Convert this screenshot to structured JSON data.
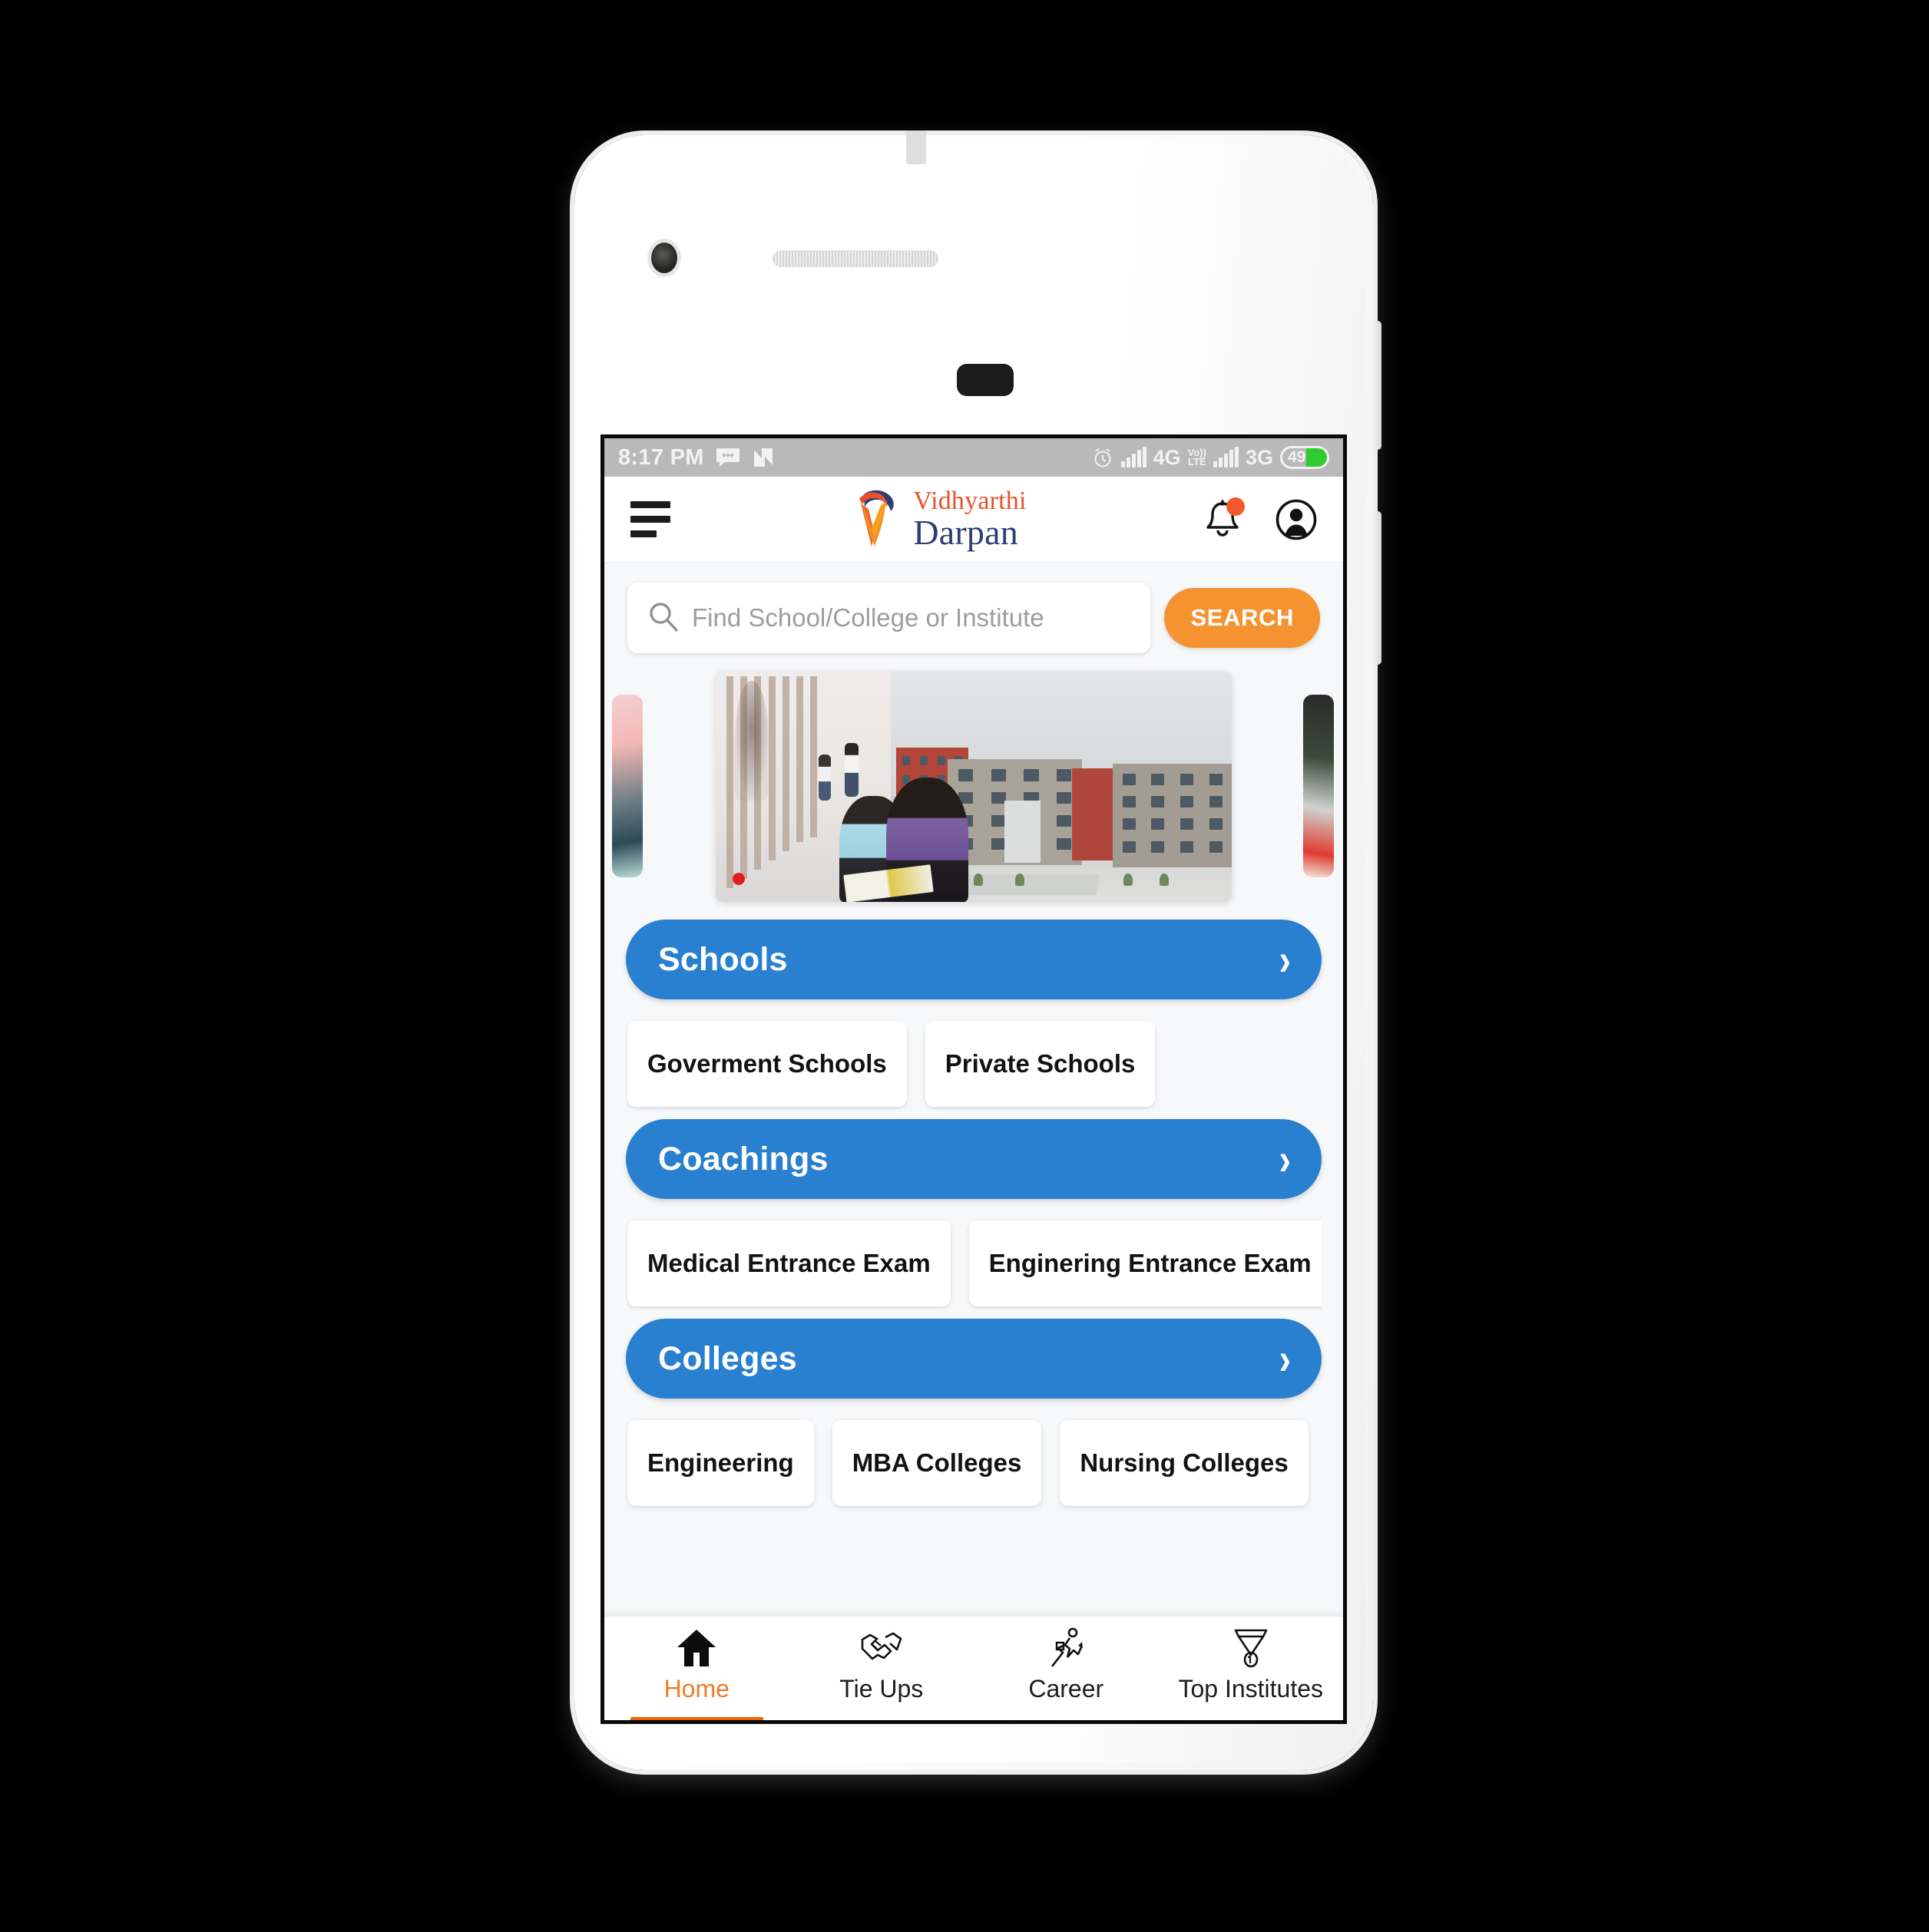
{
  "status_bar": {
    "time": "8:17 PM",
    "icons_left": [
      "sms-icon",
      "nfc-n-icon"
    ],
    "alarm_icon": "alarm-clock-icon",
    "network_1": "4G",
    "volte_top": "Vo))",
    "volte_bottom": "LTE",
    "network_2": "3G",
    "battery_level": "49",
    "bar_bg": "#b9b9b9"
  },
  "app_bar": {
    "menu_icon": "hamburger-menu-icon",
    "brand_line_1": "Vidhyarthi",
    "brand_line_2": "Darpan",
    "brand_color_1": "#e8502a",
    "brand_color_2": "#2e3d73",
    "bell_icon": "notification-bell-icon",
    "bell_badge_color": "#f4592c",
    "profile_icon": "profile-avatar-icon"
  },
  "search": {
    "placeholder": "Find School/College or Institute",
    "value": "",
    "button_label": "SEARCH",
    "button_color": "#f59331",
    "icon": "search-icon"
  },
  "carousel": {
    "active_index": 0,
    "dot_color": "#e02020",
    "slides": [
      "college-campus-students-banner",
      "previous-slide-peek",
      "next-slide-peek"
    ]
  },
  "sections": [
    {
      "title": "Schools",
      "chevron": "›",
      "color": "#2980d0",
      "chips": [
        "Goverment Schools",
        "Private Schools"
      ]
    },
    {
      "title": "Coachings",
      "chevron": "›",
      "color": "#2980d0",
      "chips": [
        "Medical Entrance Exam",
        "Enginering Entrance Exam"
      ]
    },
    {
      "title": "Colleges",
      "chevron": "›",
      "color": "#2980d0",
      "chips": [
        "Engineering",
        "MBA Colleges",
        "Nursing Colleges"
      ]
    }
  ],
  "bottom_nav": {
    "active_color": "#f07b23",
    "items": [
      {
        "label": "Home",
        "icon": "home-icon",
        "active": true
      },
      {
        "label": "Tie Ups",
        "icon": "handshake-icon",
        "active": false
      },
      {
        "label": "Career",
        "icon": "career-growth-icon",
        "active": false
      },
      {
        "label": "Top Institutes",
        "icon": "medal-icon",
        "active": false
      }
    ]
  }
}
